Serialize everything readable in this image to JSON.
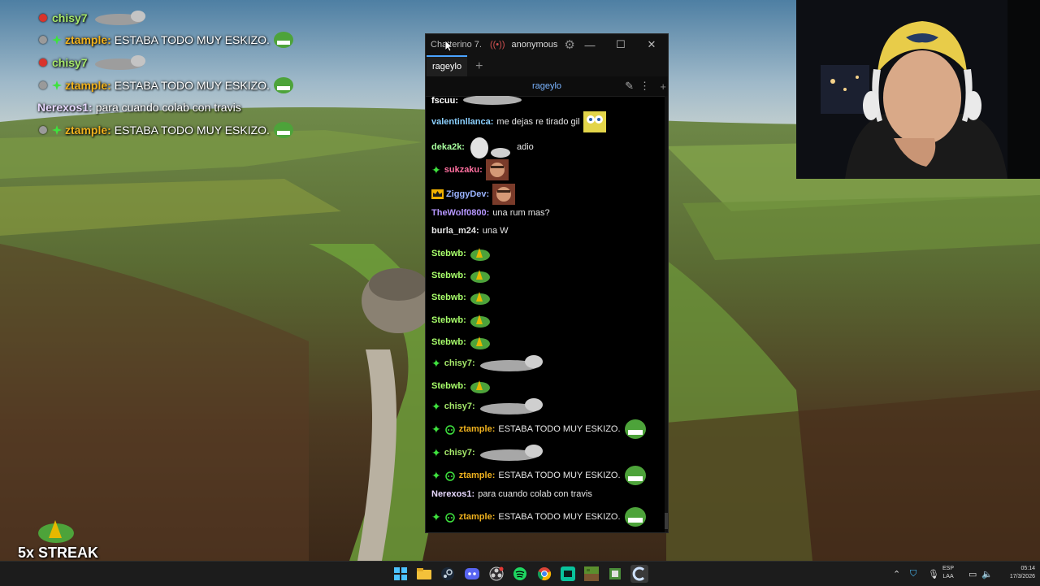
{
  "colors": {
    "chisy": "#a6e86b",
    "ztample": "#f0b21e",
    "nerexos": "#e8d9ff",
    "fscuu": "#ffffff",
    "valentinllanca": "#8bd0ff",
    "deka2k": "#a8ff9e",
    "sukzaku": "#ff6f9f",
    "ziggydev": "#9ab3ff",
    "thewolf": "#b596ff",
    "burla": "#e6e6e6",
    "stebwb": "#a8ff6b",
    "accent": "#4aa3ff"
  },
  "overlay_chat": [
    {
      "dot": "red",
      "user": "chisy7",
      "text": "",
      "emote": "cat-emote"
    },
    {
      "dot": "grey",
      "user": "ztample:",
      "text": "ESTABA TODO MUY ESKIZO.",
      "emote": "pepe-emote"
    },
    {
      "dot": "red",
      "user": "chisy7",
      "text": "",
      "emote": "cat-emote"
    },
    {
      "dot": "grey",
      "user": "ztample:",
      "text": "ESTABA TODO MUY ESKIZO.",
      "emote": "pepe-emote"
    },
    {
      "dot": "",
      "user": "Nerexos1:",
      "text": "para cuando colab con travis",
      "emote": ""
    },
    {
      "dot": "grey",
      "user": "ztample:",
      "text": "ESTABA TODO MUY ESKIZO.",
      "emote": "pepe-emote"
    }
  ],
  "window": {
    "title": "Chatterino 7.",
    "account": "anonymous",
    "tab_label": "rageylo",
    "channel_header": "rageylo"
  },
  "messages": [
    {
      "user": "fscuu:",
      "text": "",
      "emote": "cat-emote"
    },
    {
      "user": "valentinllanca:",
      "text": "me dejas re tirado gil",
      "emote": "bob-emote"
    },
    {
      "user": "deka2k:",
      "text": "adio",
      "emote": "cat-wave-emote"
    },
    {
      "user": "sukzaku:",
      "text": "",
      "emote": "face-emote",
      "badge": "star"
    },
    {
      "user": "ZiggyDev:",
      "text": "",
      "emote": "face-emote",
      "badge": "crown"
    },
    {
      "user": "TheWolf0800:",
      "text": "una rum mas?",
      "emote": ""
    },
    {
      "user": "burla_m24:",
      "text": "una W",
      "emote": ""
    },
    {
      "user": "Stebwb:",
      "text": "",
      "emote": "pepe-bell-emote"
    },
    {
      "user": "Stebwb:",
      "text": "",
      "emote": "pepe-bell-emote"
    },
    {
      "user": "Stebwb:",
      "text": "",
      "emote": "pepe-bell-emote"
    },
    {
      "user": "Stebwb:",
      "text": "",
      "emote": "pepe-bell-emote"
    },
    {
      "user": "Stebwb:",
      "text": "",
      "emote": "pepe-bell-emote"
    },
    {
      "user": "chisy7:",
      "text": "",
      "emote": "cat-emote",
      "badge": "star"
    },
    {
      "user": "Stebwb:",
      "text": "",
      "emote": "pepe-bell-emote"
    },
    {
      "user": "chisy7:",
      "text": "",
      "emote": "cat-emote",
      "badge": "star"
    },
    {
      "user": "ztample:",
      "text": "ESTABA TODO MUY ESKIZO.",
      "emote": "pepe-emote",
      "badge": "star-bot"
    },
    {
      "user": "chisy7:",
      "text": "",
      "emote": "cat-emote",
      "badge": "star"
    },
    {
      "user": "ztample:",
      "text": "ESTABA TODO MUY ESKIZO.",
      "emote": "pepe-emote",
      "badge": "star-bot"
    },
    {
      "user": "Nerexos1:",
      "text": "para cuando colab con travis",
      "emote": ""
    },
    {
      "user": "ztample:",
      "text": "ESTABA TODO MUY ESKIZO.",
      "emote": "pepe-emote",
      "badge": "star-bot"
    }
  ],
  "streak": "5x STREAK",
  "taskbar": {
    "icons": [
      "windows-start-icon",
      "file-explorer-icon",
      "steam-icon",
      "discord-icon",
      "obs-icon",
      "spotify-icon",
      "chrome-icon",
      "streamlabs-icon",
      "minecraft-icon",
      "game-icon",
      "chatterino-icon"
    ],
    "lang_top": "ESP",
    "lang_bottom": "LAA",
    "time": "05:14",
    "date": "17/3/2026"
  }
}
